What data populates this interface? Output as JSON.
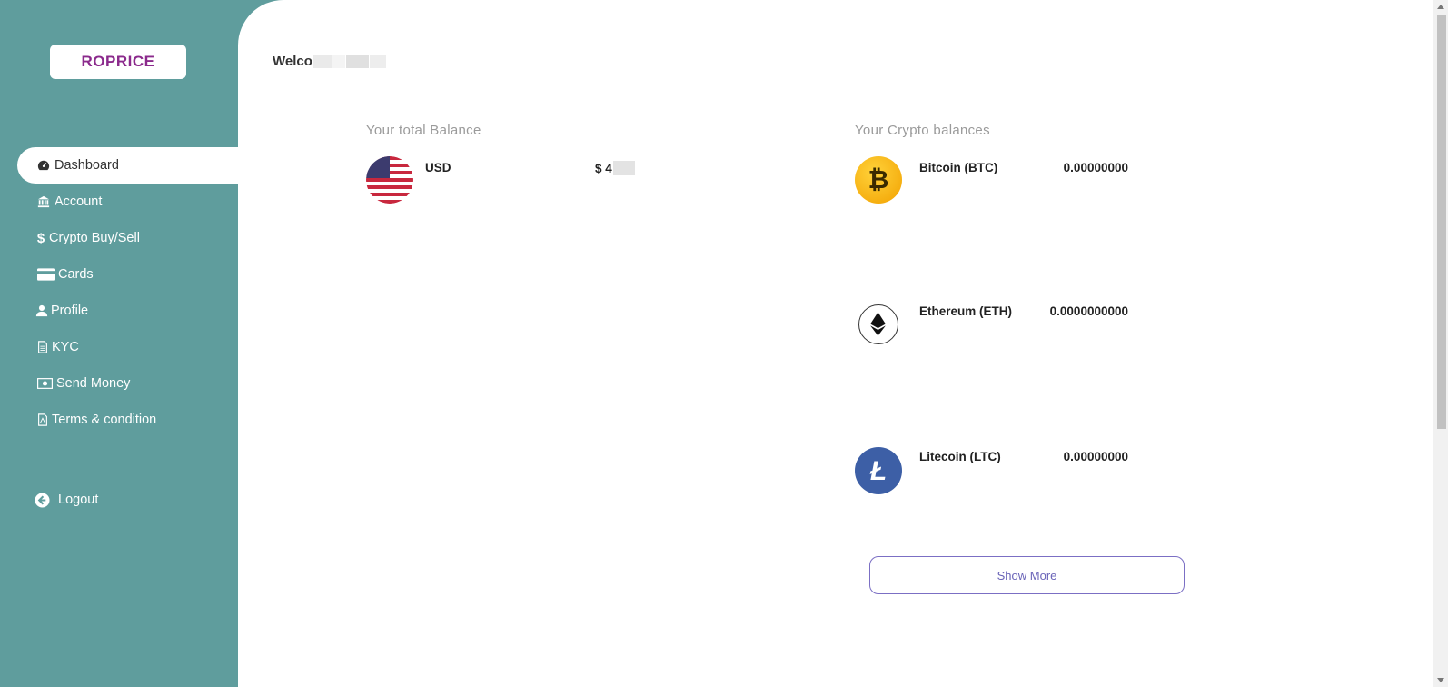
{
  "brand": {
    "logo_text": "ROPRICE"
  },
  "sidebar": {
    "items": [
      {
        "label": "Dashboard",
        "icon": "dashboard-icon"
      },
      {
        "label": "Account",
        "icon": "bank-icon"
      },
      {
        "label": "Crypto Buy/Sell",
        "icon": "dollar-icon"
      },
      {
        "label": "Cards",
        "icon": "credit-card-icon"
      },
      {
        "label": "Profile",
        "icon": "user-icon"
      },
      {
        "label": "KYC",
        "icon": "document-icon"
      },
      {
        "label": "Send Money",
        "icon": "money-icon"
      },
      {
        "label": "Terms & condition",
        "icon": "pdf-icon"
      }
    ],
    "logout_label": "Logout"
  },
  "main": {
    "welcome_prefix": "Welco",
    "total_balance_title": "Your total Balance",
    "crypto_balances_title": "Your Crypto balances",
    "fiat": {
      "currency": "USD",
      "amount_prefix": "$ 4"
    },
    "crypto": [
      {
        "name": "Bitcoin (BTC)",
        "balance": "0.00000000",
        "icon": "bitcoin-icon"
      },
      {
        "name": "Ethereum (ETH)",
        "balance": "0.0000000000",
        "icon": "ethereum-icon"
      },
      {
        "name": "Litecoin (LTC)",
        "balance": "0.00000000",
        "icon": "litecoin-icon"
      }
    ],
    "show_more_label": "Show More"
  },
  "colors": {
    "sidebar": "#5f9d9d",
    "brand": "#8b2a8c",
    "accent": "#7b6fc4"
  }
}
